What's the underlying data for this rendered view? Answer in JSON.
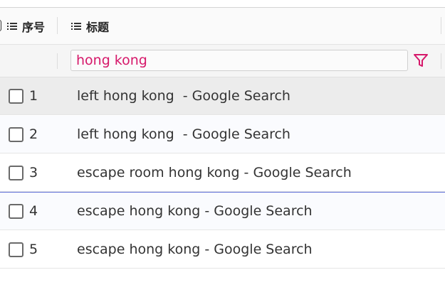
{
  "table": {
    "columns": [
      {
        "label": "序号",
        "icon": "list-icon"
      },
      {
        "label": "标题",
        "icon": "list-icon"
      }
    ],
    "filter": {
      "value": "hong kong",
      "icon": "filter-icon",
      "accent": "#d6186a"
    },
    "rows": [
      {
        "num": "1",
        "title": "left hong kong  - Google Search",
        "checked": false
      },
      {
        "num": "2",
        "title": "left hong kong  - Google Search",
        "checked": false
      },
      {
        "num": "3",
        "title": "escape room hong kong - Google Search",
        "checked": false
      },
      {
        "num": "4",
        "title": "escape hong kong - Google Search",
        "checked": false
      },
      {
        "num": "5",
        "title": "escape hong kong - Google Search",
        "checked": false
      }
    ]
  }
}
